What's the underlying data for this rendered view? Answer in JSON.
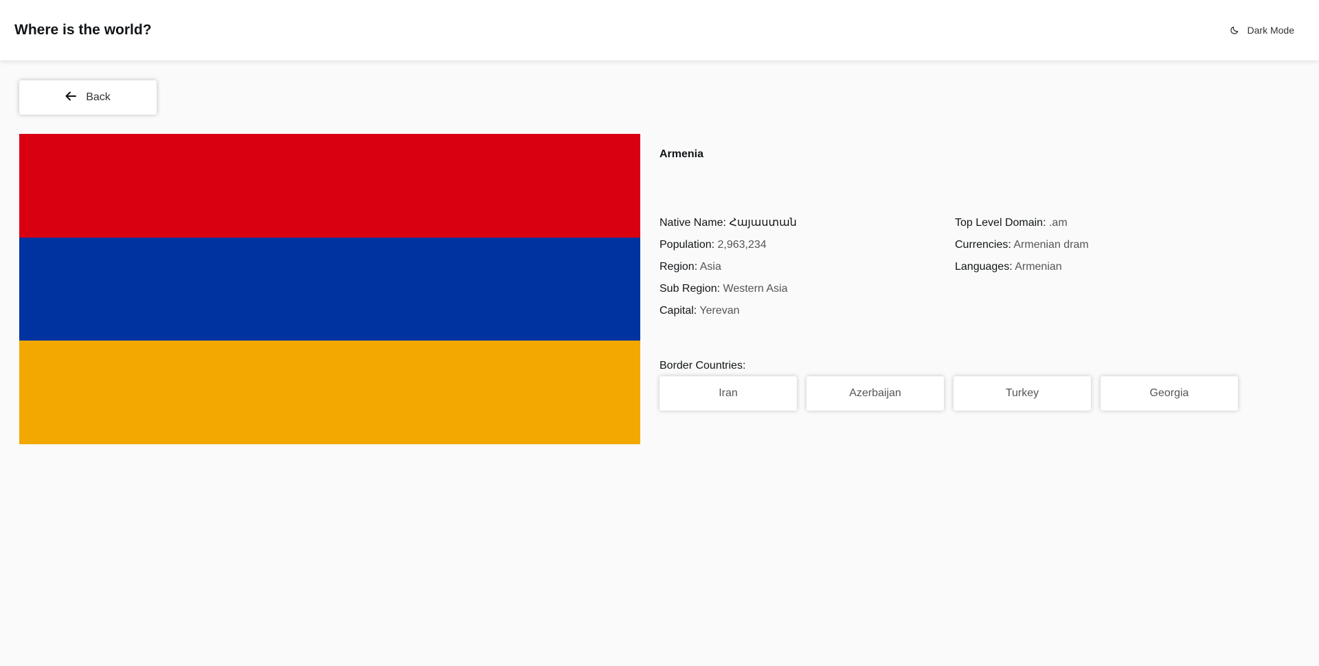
{
  "header": {
    "title": "Where is the world?",
    "theme_toggle": {
      "icon": "moon-icon",
      "label": "Dark Mode"
    }
  },
  "back_button": {
    "icon": "arrow-left-icon",
    "label": "Back"
  },
  "flag": {
    "stripes": [
      "#d90012",
      "#0033a0",
      "#f2a800"
    ]
  },
  "country": {
    "name": "Armenia",
    "labels": {
      "native_name": "Native Name:",
      "population": "Population:",
      "region": "Region:",
      "sub_region": "Sub Region:",
      "capital": "Capital:",
      "top_level_domain": "Top Level Domain:",
      "currencies": "Currencies:",
      "languages": "Languages:"
    },
    "native_name": "Հայաստան",
    "population": "2,963,234",
    "region": "Asia",
    "sub_region": "Western Asia",
    "capital": "Yerevan",
    "top_level_domain": ".am",
    "currencies": "Armenian dram",
    "languages": "Armenian"
  },
  "border_countries": {
    "label": "Border Countries:",
    "items": [
      "Iran",
      "Azerbaijan",
      "Turkey",
      "Georgia"
    ]
  }
}
